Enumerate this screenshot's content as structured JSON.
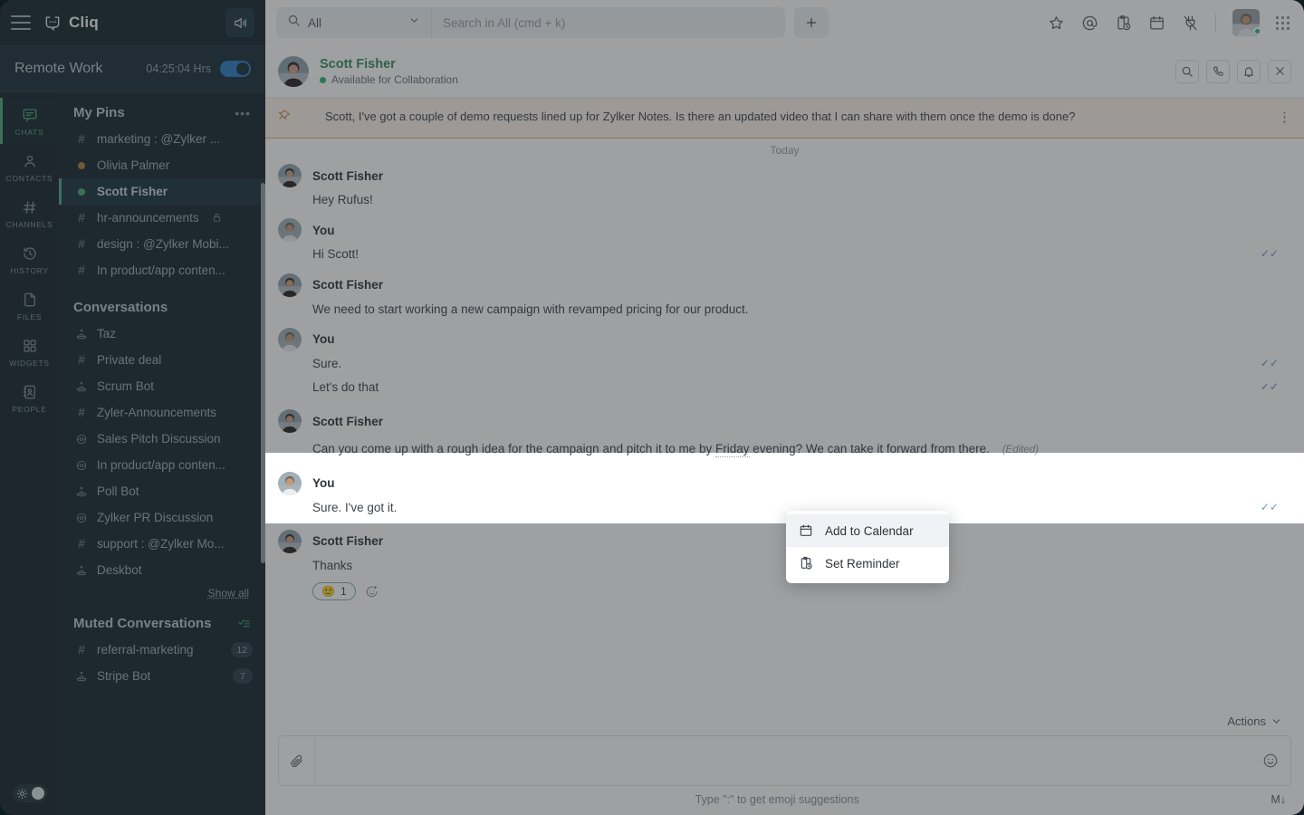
{
  "app": {
    "brand": "Cliq",
    "theme_toggle": "theme-toggle"
  },
  "status_bar": {
    "name": "Remote Work",
    "time": "04:25:04 Hrs"
  },
  "rail": [
    {
      "label": "CHATS",
      "icon": "chat-icon",
      "active": true
    },
    {
      "label": "CONTACTS",
      "icon": "person-icon",
      "active": false
    },
    {
      "label": "CHANNELS",
      "icon": "hash-icon",
      "active": false
    },
    {
      "label": "HISTORY",
      "icon": "history-icon",
      "active": false
    },
    {
      "label": "FILES",
      "icon": "file-icon",
      "active": false
    },
    {
      "label": "WIDGETS",
      "icon": "widgets-icon",
      "active": false
    },
    {
      "label": "PEOPLE",
      "icon": "people-icon",
      "active": false
    }
  ],
  "sidebar": {
    "pins": {
      "title": "My Pins",
      "more": "•••",
      "items": [
        {
          "label": "marketing : @Zylker ...",
          "glyph": "#",
          "type": "channel"
        },
        {
          "label": "Olivia Palmer",
          "glyph": "dot",
          "type": "user",
          "dot_color": "#b07c38"
        },
        {
          "label": "Scott Fisher",
          "glyph": "dot",
          "type": "user",
          "dot_color": "#4ea87c",
          "selected": true
        },
        {
          "label": "hr-announcements",
          "glyph": "#",
          "type": "channel",
          "locked": true
        },
        {
          "label": "design : @Zylker Mobi...",
          "glyph": "#",
          "type": "channel"
        },
        {
          "label": "In product/app conten...",
          "glyph": "#",
          "type": "channel"
        }
      ]
    },
    "conversations": {
      "title": "Conversations",
      "show_all": "Show all",
      "items": [
        {
          "label": "Taz",
          "glyph": "bot"
        },
        {
          "label": "Private deal",
          "glyph": "#"
        },
        {
          "label": "Scrum Bot",
          "glyph": "bot"
        },
        {
          "label": "Zyler-Announcements",
          "glyph": "#"
        },
        {
          "label": "Sales Pitch Discussion",
          "glyph": "group"
        },
        {
          "label": "In product/app conten...",
          "glyph": "group"
        },
        {
          "label": "Poll Bot",
          "glyph": "bot"
        },
        {
          "label": "Zylker PR Discussion",
          "glyph": "group"
        },
        {
          "label": "support : @Zylker Mo...",
          "glyph": "#"
        },
        {
          "label": "Deskbot",
          "glyph": "bot"
        }
      ]
    },
    "muted": {
      "title": "Muted Conversations",
      "items": [
        {
          "label": "referral-marketing",
          "glyph": "#",
          "badge": "12"
        },
        {
          "label": "Stripe Bot",
          "glyph": "bot",
          "badge": "7"
        }
      ]
    }
  },
  "topbar": {
    "search_scope": "All",
    "search_placeholder": "Search in All (cmd + k)",
    "search_value": "",
    "new_label": "+",
    "icons": [
      "star-icon",
      "mention-icon",
      "reminder-icon",
      "calendar-icon",
      "plug-icon",
      "grid-icon"
    ]
  },
  "chat_header": {
    "name": "Scott Fisher",
    "status": "Available for Collaboration",
    "actions": [
      "search-icon",
      "call-icon",
      "bell-icon",
      "close-icon"
    ]
  },
  "pinned": {
    "text": "Scott, I've got a couple of demo requests lined up for Zylker Notes. Is there an updated video that I can share with them once the demo is done?",
    "more": "⋮"
  },
  "conversation": {
    "day_divider": "Today",
    "messages": [
      {
        "author": "Scott Fisher",
        "lines": [
          "Hey Rufus!"
        ],
        "self": false
      },
      {
        "author": "You",
        "lines": [
          "Hi Scott!"
        ],
        "self": true,
        "ticks": "✓✓"
      },
      {
        "author": "Scott Fisher",
        "lines": [
          "We need to start working a new campaign with revamped pricing for our product."
        ],
        "self": false
      },
      {
        "author": "You",
        "lines": [
          "Sure.",
          "Let's do that"
        ],
        "self": true,
        "ticks": "✓✓"
      },
      {
        "author": "Scott Fisher",
        "self": false,
        "highlighted": true,
        "text_before": "Can you come up with a rough idea for the campaign and pitch it to me by ",
        "smart_date": "Friday",
        "text_after": " evening? We can take it forward from there.",
        "edited": "(Edited)"
      },
      {
        "author": "You",
        "lines": [
          "Sure. I've got it."
        ],
        "self": true,
        "ticks": "✓✓"
      },
      {
        "author": "Scott Fisher",
        "lines": [
          "Thanks"
        ],
        "self": false,
        "reaction": {
          "emoji": "🙂",
          "count": "1"
        }
      }
    ]
  },
  "context_menu": {
    "items": [
      {
        "label": "Add to Calendar",
        "icon": "calendar-icon",
        "hover": true
      },
      {
        "label": "Set Reminder",
        "icon": "reminder-icon",
        "hover": false
      }
    ]
  },
  "composer": {
    "actions_label": "Actions",
    "placeholder": "",
    "value": "",
    "hint": "Type \":\" to get emoji suggestions",
    "markdown_label": "M↓"
  },
  "colors": {
    "sidebar_bg": "#16262e",
    "rail_bg": "#14242b",
    "accent_green": "#4ea87c",
    "brand_green": "#3a8f5f",
    "pinned_bg": "#fbf2e9",
    "pinned_border": "#eab06b",
    "toggle_blue": "#2a7fc4"
  }
}
